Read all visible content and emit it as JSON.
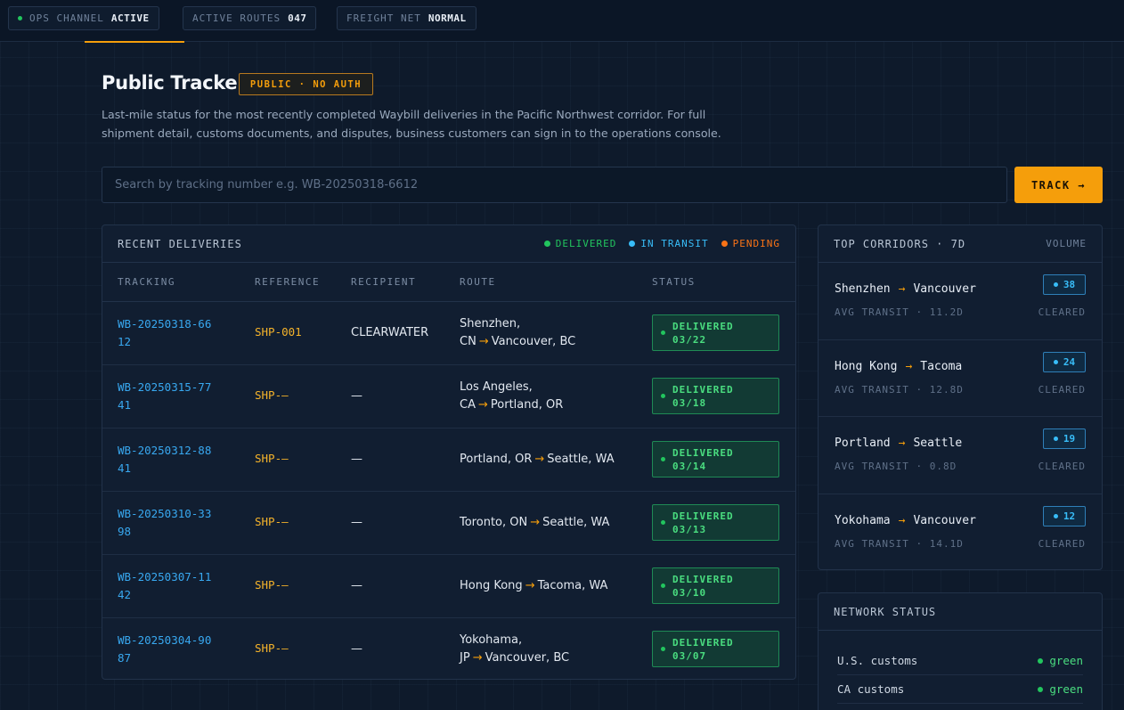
{
  "topbar": {
    "ops": {
      "label": "OPS CHANNEL",
      "value": "ACTIVE"
    },
    "routes": {
      "label": "ACTIVE ROUTES",
      "value": "047"
    },
    "freight": {
      "label": "FREIGHT NET",
      "value": "NORMAL"
    }
  },
  "header": {
    "title": "Public Tracker",
    "badge": "PUBLIC · NO AUTH",
    "description": "Last-mile status for the most recently completed Waybill deliveries in the Pacific Northwest corridor. For full shipment detail, customs documents, and disputes, business customers can sign in to the operations console."
  },
  "search": {
    "placeholder": "Search by tracking number e.g. WB-20250318-6612",
    "button_label": "TRACK →"
  },
  "deliveries": {
    "title": "RECENT DELIVERIES",
    "legend": [
      {
        "label": "DELIVERED",
        "color": "#22c55e"
      },
      {
        "label": "IN TRANSIT",
        "color": "#38bdf8"
      },
      {
        "label": "PENDING",
        "color": "#f97316"
      }
    ],
    "columns": [
      "TRACKING",
      "REFERENCE",
      "RECIPIENT",
      "ROUTE",
      "STATUS"
    ],
    "rows": [
      {
        "tracking": "WB-20250318-6612",
        "reference": "SHP-001",
        "recipient": "CLEARWATER",
        "origin": "Shenzhen, CN",
        "destination": "Vancouver, BC",
        "status": "DELIVERED",
        "date": "03/22"
      },
      {
        "tracking": "WB-20250315-7741",
        "reference": "SHP-—",
        "recipient": "—",
        "origin": "Los Angeles, CA",
        "destination": "Portland, OR",
        "status": "DELIVERED",
        "date": "03/18"
      },
      {
        "tracking": "WB-20250312-8841",
        "reference": "SHP-—",
        "recipient": "—",
        "origin": "Portland, OR",
        "destination": "Seattle, WA",
        "status": "DELIVERED",
        "date": "03/14"
      },
      {
        "tracking": "WB-20250310-3398",
        "reference": "SHP-—",
        "recipient": "—",
        "origin": "Toronto, ON",
        "destination": "Seattle, WA",
        "status": "DELIVERED",
        "date": "03/13"
      },
      {
        "tracking": "WB-20250307-1142",
        "reference": "SHP-—",
        "recipient": "—",
        "origin": "Hong Kong",
        "destination": "Tacoma, WA",
        "status": "DELIVERED",
        "date": "03/10"
      },
      {
        "tracking": "WB-20250304-9087",
        "reference": "SHP-—",
        "recipient": "—",
        "origin": "Yokohama, JP",
        "destination": "Vancouver, BC",
        "status": "DELIVERED",
        "date": "03/07"
      }
    ]
  },
  "corridors": {
    "title": "TOP CORRIDORS · 7D",
    "volume_label": "VOLUME",
    "items": [
      {
        "from": "Shenzhen",
        "to": "Vancouver",
        "volume": "38",
        "transit": "AVG TRANSIT · 11.2D",
        "status": "CLEARED"
      },
      {
        "from": "Hong Kong",
        "to": "Tacoma",
        "volume": "24",
        "transit": "AVG TRANSIT · 12.8D",
        "status": "CLEARED"
      },
      {
        "from": "Portland",
        "to": "Seattle",
        "volume": "19",
        "transit": "AVG TRANSIT · 0.8D",
        "status": "CLEARED"
      },
      {
        "from": "Yokohama",
        "to": "Vancouver",
        "volume": "12",
        "transit": "AVG TRANSIT · 14.1D",
        "status": "CLEARED"
      }
    ]
  },
  "network": {
    "title": "NETWORK STATUS",
    "items": [
      {
        "label": "U.S. customs",
        "value": "green"
      },
      {
        "label": "CA customs",
        "value": "green"
      }
    ]
  },
  "colors": {
    "accent": "#f59e0b",
    "link": "#38a8f0",
    "delivered": "#22c55e",
    "background": "#0e1a2b"
  }
}
